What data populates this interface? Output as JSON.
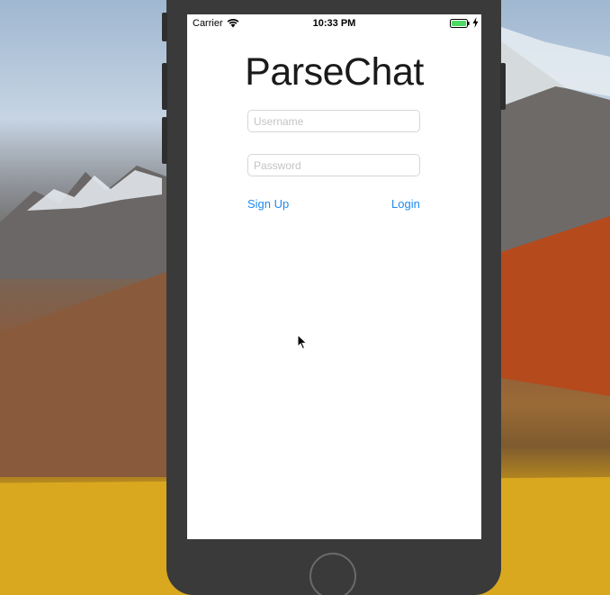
{
  "status_bar": {
    "carrier": "Carrier",
    "time": "10:33 PM",
    "wifi_icon": "wifi-icon",
    "battery_icon": "battery-icon",
    "charge_icon": "charging-bolt-icon",
    "battery_color": "#4cd964"
  },
  "login_screen": {
    "title": "ParseChat",
    "username_placeholder": "Username",
    "password_placeholder": "Password",
    "sign_up_label": "Sign Up",
    "login_label": "Login",
    "accent_color": "#1e8bf0"
  },
  "device": {
    "home_button_icon": "home-button"
  }
}
